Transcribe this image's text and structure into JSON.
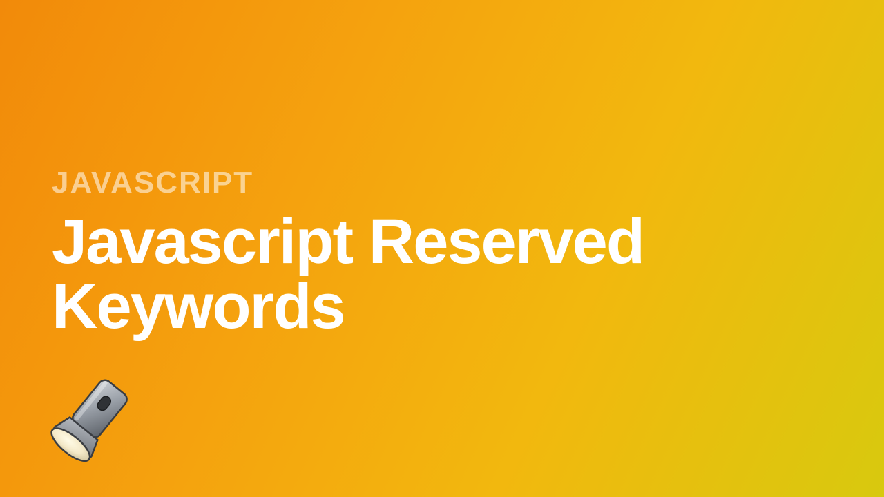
{
  "eyebrow": "JAVASCRIPT",
  "title": "Javascript Reserved Keywords",
  "icon": "flashlight-icon",
  "colors": {
    "gradient_start": "#f28a0a",
    "gradient_end": "#d8c90e",
    "text": "#ffffff",
    "eyebrow": "rgba(255,255,255,0.55)"
  }
}
